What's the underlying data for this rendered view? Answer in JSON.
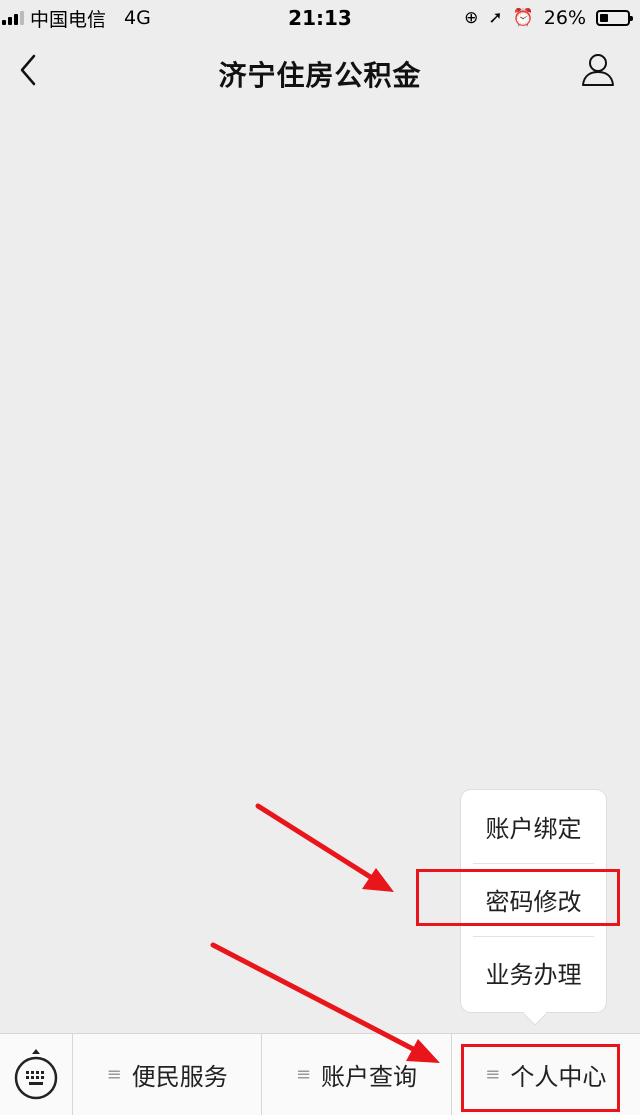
{
  "status_bar": {
    "carrier": "中国电信",
    "network": "4G",
    "time": "21:13",
    "battery": "26%"
  },
  "nav": {
    "title": "济宁住房公积金"
  },
  "popup_menu": {
    "items": [
      "账户绑定",
      "密码修改",
      "业务办理"
    ]
  },
  "bottom_menu": {
    "tabs": [
      "便民服务",
      "账户查询",
      "个人中心"
    ]
  },
  "colors": {
    "annotation": "#e8161b",
    "background": "#ededed"
  }
}
